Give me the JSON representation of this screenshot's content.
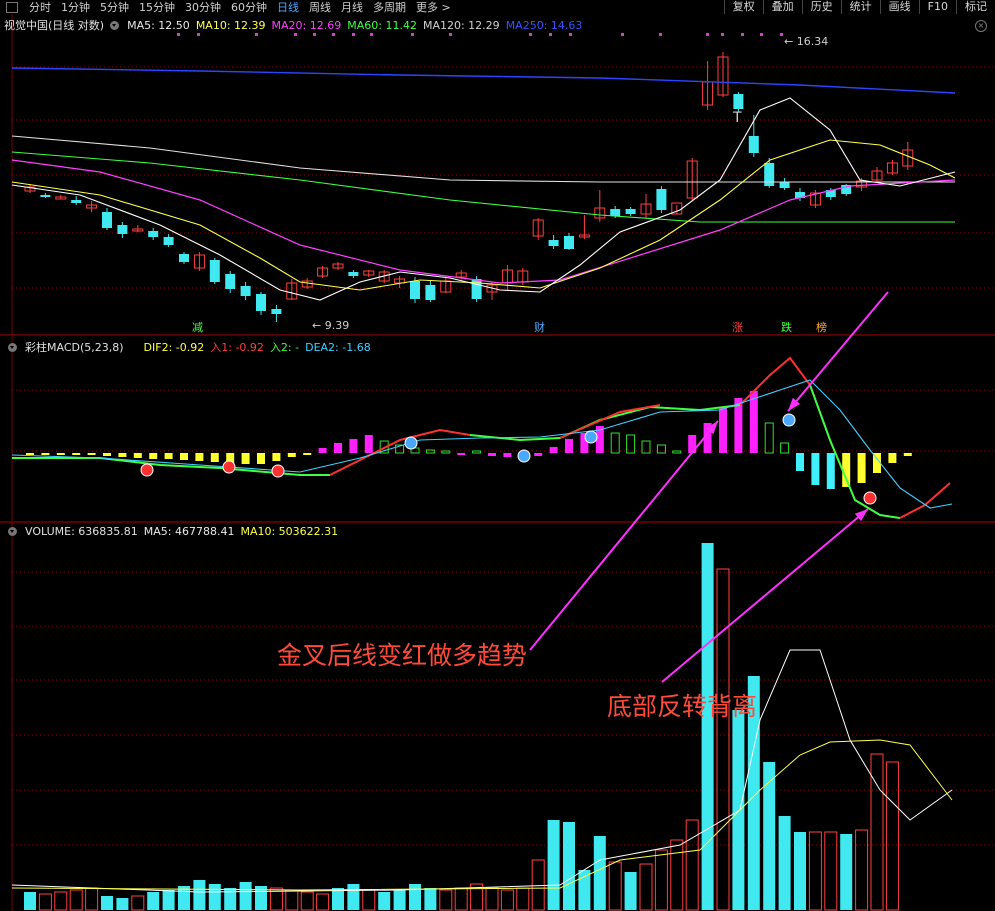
{
  "toolbar": {
    "periods": [
      "分时",
      "1分钟",
      "5分钟",
      "15分钟",
      "30分钟",
      "60分钟",
      "日线",
      "周线",
      "月线",
      "多周期",
      "更多 >"
    ],
    "active_period": "日线",
    "right_buttons": [
      "复权",
      "叠加",
      "历史",
      "统计",
      "画线",
      "F10",
      "标记"
    ]
  },
  "main_panel": {
    "title": "视觉中国(日线 对数)",
    "ma": [
      {
        "label": "MA5: 12.50",
        "color": "#e8e8e8"
      },
      {
        "label": "MA10: 12.39",
        "color": "#ffff4a"
      },
      {
        "label": "MA20: 12.69",
        "color": "#ff40ff"
      },
      {
        "label": "MA60: 11.42",
        "color": "#40ff40"
      },
      {
        "label": "MA120: 12.29",
        "color": "#d0d0d0"
      },
      {
        "label": "MA250: 14.63",
        "color": "#3355ff"
      }
    ],
    "high_label": "16.34",
    "low_label": "9.39",
    "markers": [
      {
        "text": "减",
        "color": "#40ff40"
      },
      {
        "text": "财",
        "color": "#55aaff"
      },
      {
        "text": "涨",
        "color": "#ff4040"
      },
      {
        "text": "跌",
        "color": "#40ff40"
      },
      {
        "text": "榜",
        "color": "#ffaa30"
      }
    ]
  },
  "macd_panel": {
    "title": "彩柱MACD(5,23,8)",
    "items": [
      {
        "label": "DIF2: -0.92",
        "color": "#ffff40"
      },
      {
        "label": "入1: -0.92",
        "color": "#ff4040"
      },
      {
        "label": "入2: -",
        "color": "#40ff40"
      },
      {
        "label": "DEA2: -1.68",
        "color": "#40d0ff"
      }
    ]
  },
  "volume_panel": {
    "title": "VOLUME: 636835.81",
    "items": [
      {
        "label": "MA5: 467788.41",
        "color": "#e8e8e8"
      },
      {
        "label": "MA10: 503622.31",
        "color": "#ffff4a"
      }
    ]
  },
  "annotations": {
    "golden_cross": "金叉后线变红做多趋势",
    "bottom_divergence": "底部反转背离"
  },
  "colors": {
    "up": "#ff4040",
    "down": "#40e8f0",
    "bg": "#000000",
    "grid": "#8b0000"
  }
}
